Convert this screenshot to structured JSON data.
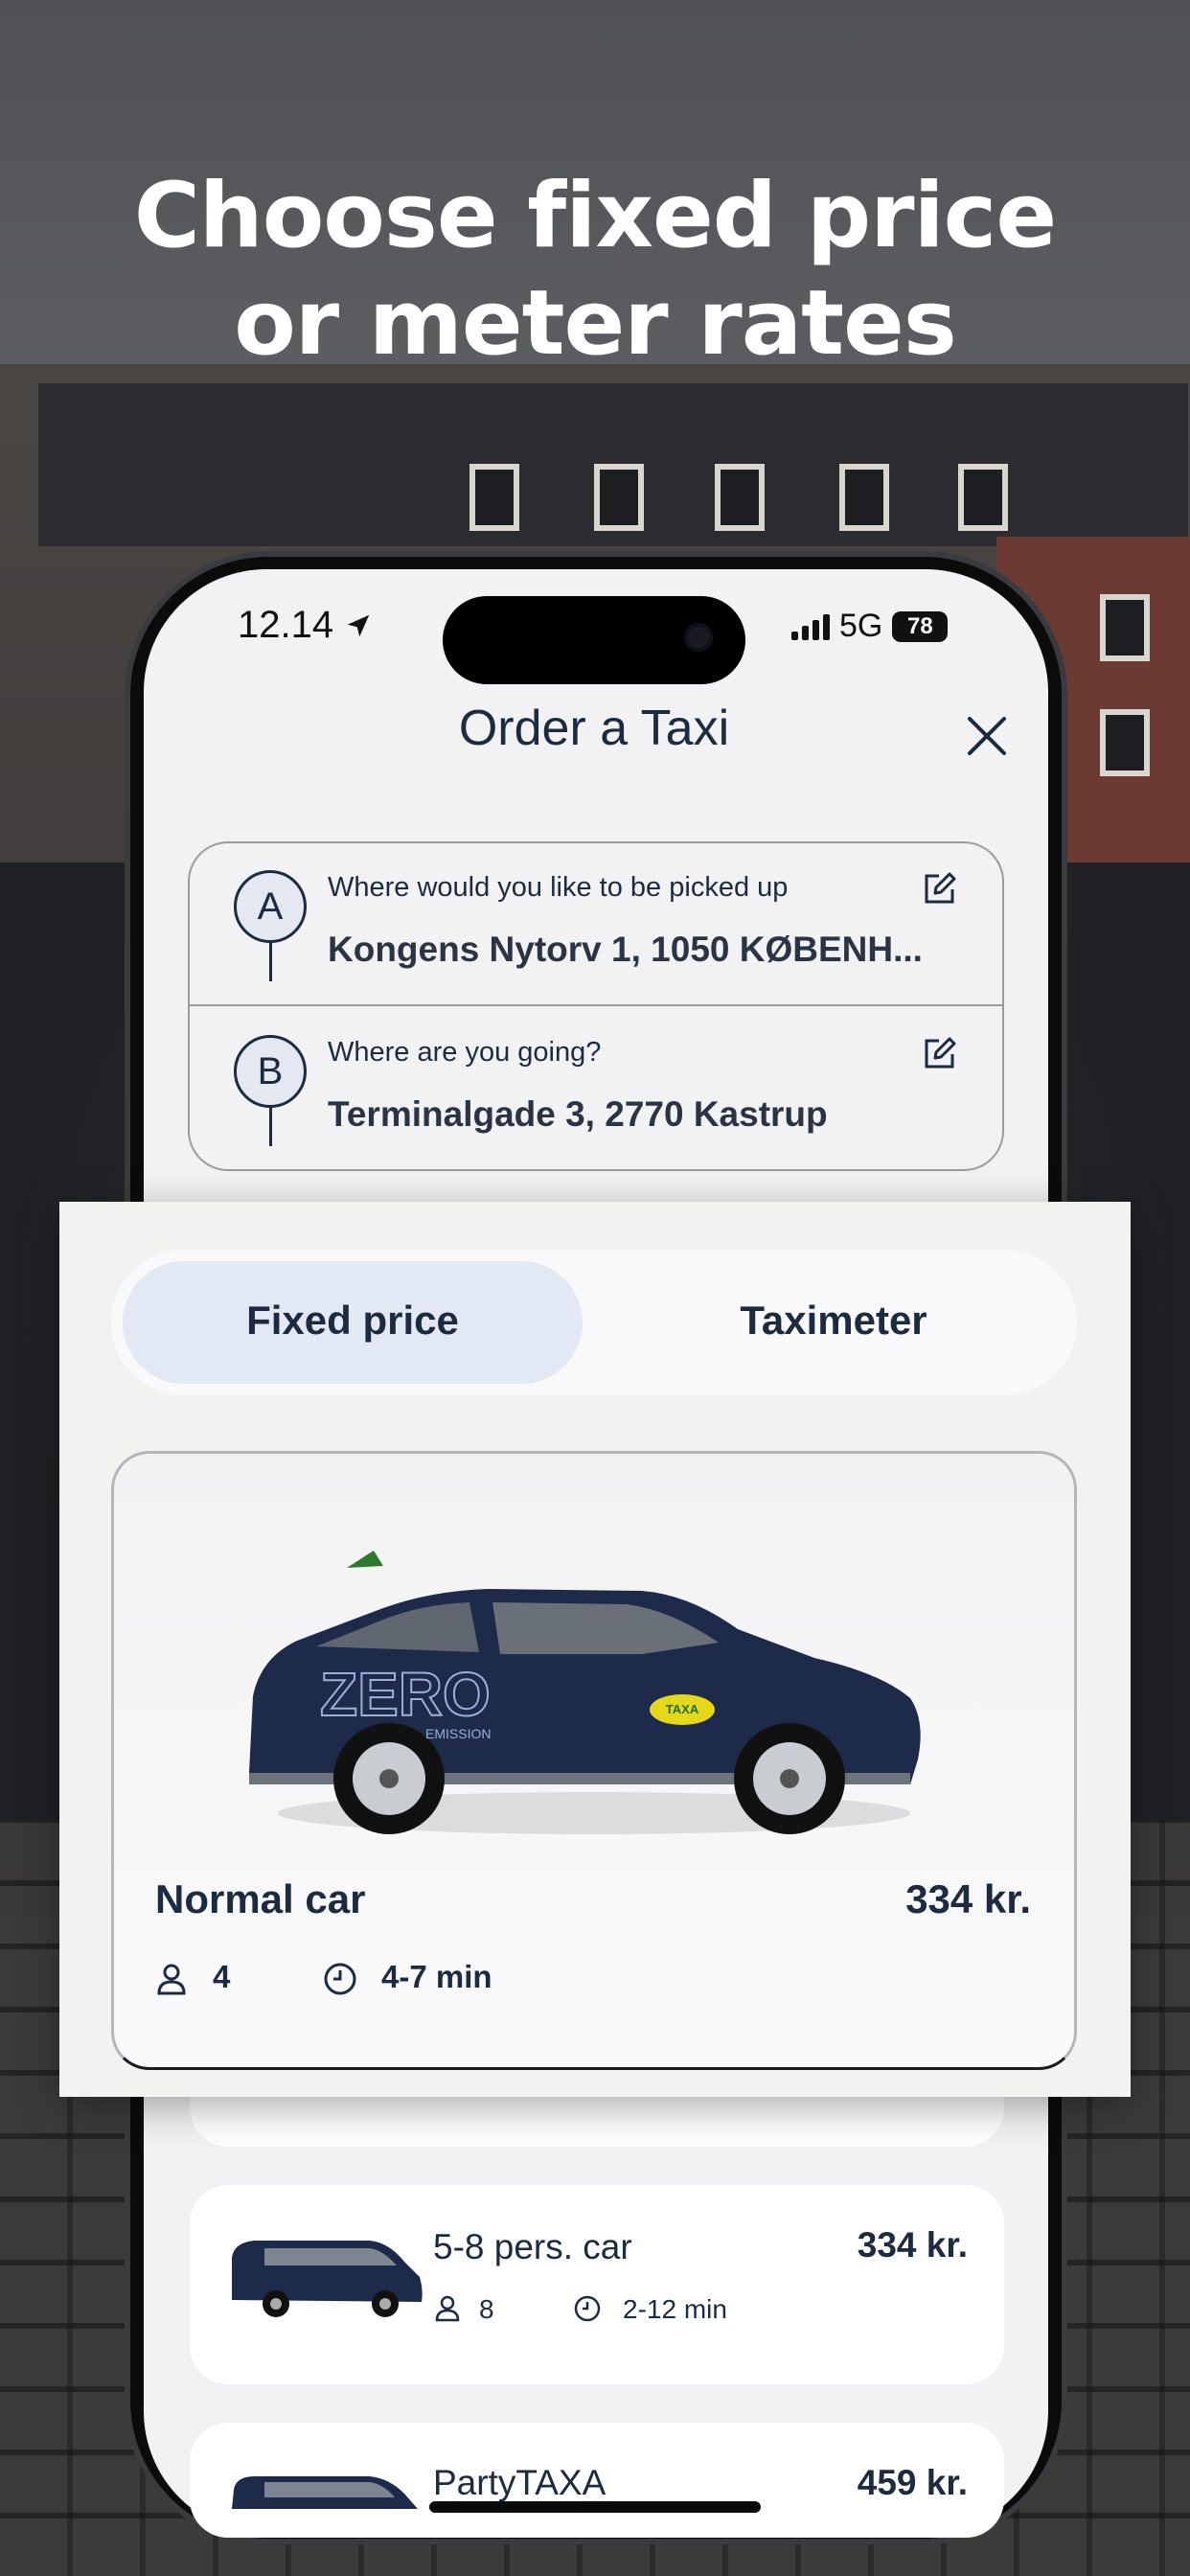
{
  "headline": {
    "line1": "Choose fixed price",
    "line2": "or meter rates"
  },
  "status_bar": {
    "time": "12.14",
    "network": "5G",
    "battery": "78"
  },
  "header": {
    "title": "Order a Taxi",
    "close_icon": "close-icon"
  },
  "pickup": {
    "marker": "A",
    "label": "Where would you like to be picked up",
    "value": "Kongens Nytorv 1, 1050 KØBENH..."
  },
  "destination": {
    "marker": "B",
    "label": "Where are you going?",
    "value": "Terminalgade 3, 2770 Kastrup"
  },
  "price_mode": {
    "options": [
      "Fixed price",
      "Taximeter"
    ],
    "selected": "Fixed price"
  },
  "selected_car": {
    "name": "Normal car",
    "price": "334 kr.",
    "seats": "4",
    "eta": "4-7 min",
    "image_text": {
      "big": "ZERO",
      "small": "EMISSION",
      "badge": "TAXA"
    }
  },
  "car_list": [
    {
      "name": "5-8 pers. car",
      "price": "334 kr.",
      "seats": "8",
      "eta": "2-12 min"
    },
    {
      "name": "PartyTAXA",
      "price": "459 kr."
    }
  ],
  "colors": {
    "navy": "#1c2b40",
    "segment_active": "#e3e9f4",
    "screen_bg": "#f2f2f4",
    "car_body": "#1d2a49"
  }
}
